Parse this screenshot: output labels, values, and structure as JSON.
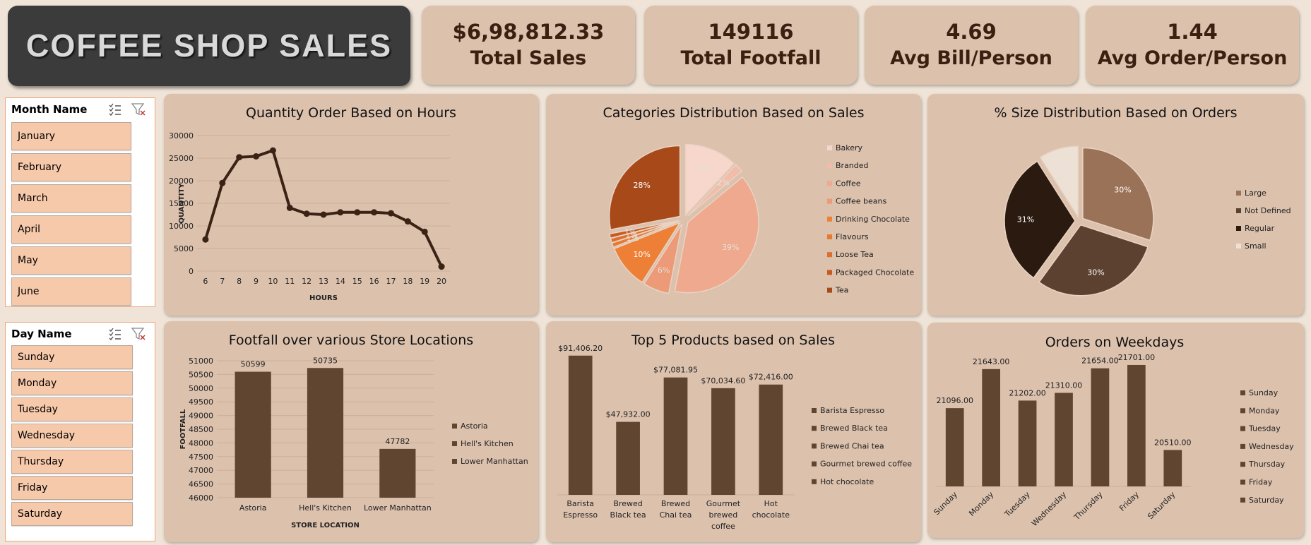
{
  "header": {
    "title": "COFFEE SHOP SALES"
  },
  "kpis": [
    {
      "value": "$6,98,812.33",
      "label": "Total Sales"
    },
    {
      "value": "149116",
      "label": "Total Footfall"
    },
    {
      "value": "4.69",
      "label": "Avg Bill/Person"
    },
    {
      "value": "1.44",
      "label": "Avg Order/Person"
    }
  ],
  "slicers": {
    "month": {
      "title": "Month Name",
      "items": [
        "January",
        "February",
        "March",
        "April",
        "May",
        "June"
      ]
    },
    "day": {
      "title": "Day Name",
      "items": [
        "Sunday",
        "Monday",
        "Tuesday",
        "Wednesday",
        "Thursday",
        "Friday",
        "Saturday"
      ]
    }
  },
  "chart_data": [
    {
      "type": "line",
      "title": "Quantity Order Based on Hours",
      "xlabel": "HOURS",
      "ylabel": "QUANTITY",
      "x": [
        6,
        7,
        8,
        9,
        10,
        11,
        12,
        13,
        14,
        15,
        16,
        17,
        18,
        19,
        20
      ],
      "values": [
        7000,
        19500,
        25200,
        25400,
        26700,
        14000,
        12700,
        12500,
        13000,
        13000,
        13000,
        12800,
        11000,
        8700,
        1000
      ],
      "ylim": [
        0,
        30000
      ],
      "yticks": [
        0,
        5000,
        10000,
        15000,
        20000,
        25000,
        30000
      ],
      "color": "#3a2315"
    },
    {
      "type": "pie",
      "title": "Categories Distribution Based on Sales",
      "categories": [
        "Bakery",
        "Branded",
        "Coffee",
        "Coffee beans",
        "Drinking Chocolate",
        "Flavours",
        "Loose Tea",
        "Packaged Chocolate",
        "Tea"
      ],
      "values": [
        12,
        2,
        39,
        6,
        10,
        1,
        1,
        1,
        28
      ],
      "labels": [
        "12%",
        "2%",
        "39%",
        "6%",
        "10%",
        "1%",
        "1%",
        "1%",
        "28%"
      ],
      "colors": [
        "#f7d6cb",
        "#f2bcab",
        "#eea98e",
        "#ec9a77",
        "#ed8036",
        "#e57a33",
        "#dc6f2f",
        "#c65a21",
        "#a8491a"
      ],
      "legend": "right"
    },
    {
      "type": "pie",
      "title": "% Size Distribution Based on Orders",
      "categories": [
        "Large",
        "Not Defined",
        "Regular",
        "Small"
      ],
      "values": [
        30,
        30,
        31,
        9
      ],
      "labels": [
        "30%",
        "30%",
        "31%",
        "9%"
      ],
      "colors": [
        "#9a7258",
        "#5c4030",
        "#2b1a10",
        "#ede1d5"
      ],
      "legend": "right"
    },
    {
      "type": "bar",
      "title": "Footfall over various Store Locations",
      "xlabel": "STORE LOCATION",
      "ylabel": "FOOTFALL",
      "categories": [
        "Astoria",
        "Hell's Kitchen",
        "Lower Manhattan"
      ],
      "values": [
        50599,
        50735,
        47782
      ],
      "labels": [
        "50599",
        "50735",
        "47782"
      ],
      "ylim": [
        46000,
        51000
      ],
      "yticks": [
        46000,
        46500,
        47000,
        47500,
        48000,
        48500,
        49000,
        49500,
        50000,
        50500,
        51000
      ],
      "legend_entries": [
        "Astoria",
        "Hell's Kitchen",
        "Lower Manhattan"
      ],
      "color": "#604530"
    },
    {
      "type": "bar",
      "title": "Top 5 Products based on Sales",
      "categories": [
        "Barista Espresso",
        "Brewed Black tea",
        "Brewed Chai tea",
        "Gourmet brewed coffee",
        "Hot chocolate"
      ],
      "values": [
        91406.2,
        47932.0,
        77081.95,
        70034.6,
        72416.0
      ],
      "labels": [
        "$91,406.20",
        "$47,932.00",
        "$77,081.95",
        "$70,034.60",
        "$72,416.00"
      ],
      "tick_labels": [
        [
          "Barista",
          "Espresso"
        ],
        [
          "Brewed",
          "Black tea"
        ],
        [
          "Brewed",
          "Chai tea"
        ],
        [
          "Gourmet",
          "brewed",
          "coffee"
        ],
        [
          "Hot",
          "chocolate"
        ]
      ],
      "ylim": [
        0,
        95000
      ],
      "legend_entries": [
        "Barista Espresso",
        "Brewed Black tea",
        "Brewed Chai tea",
        "Gourmet brewed coffee",
        "Hot chocolate"
      ],
      "color": "#604530"
    },
    {
      "type": "bar",
      "title": "Orders on Weekdays",
      "categories": [
        "Sunday",
        "Monday",
        "Tuesday",
        "Wednesday",
        "Thursday",
        "Friday",
        "Saturday"
      ],
      "values": [
        21096,
        21643,
        21202,
        21310,
        21654,
        21701,
        20510
      ],
      "labels": [
        "21096.00",
        "21643.00",
        "21202.00",
        "21310.00",
        "21654.00",
        "21701.00",
        "20510.00"
      ],
      "ylim": [
        20000,
        21750
      ],
      "legend_entries": [
        "Sunday",
        "Monday",
        "Tuesday",
        "Wednesday",
        "Thursday",
        "Friday",
        "Saturday"
      ],
      "color": "#604530"
    }
  ]
}
